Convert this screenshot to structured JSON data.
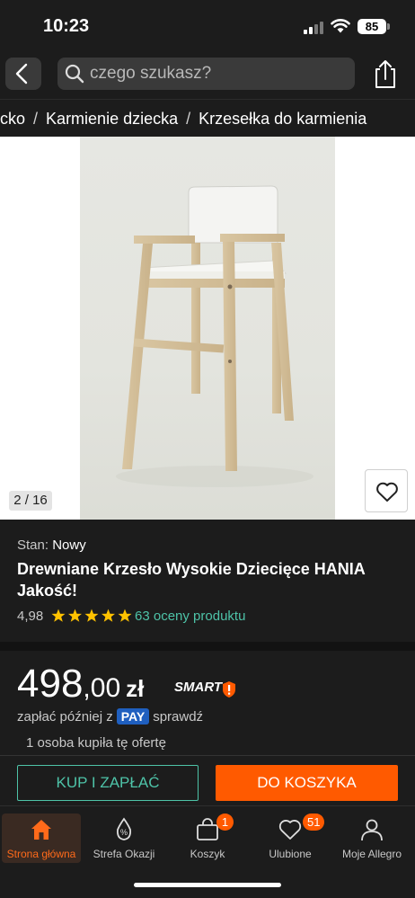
{
  "status_bar": {
    "time": "10:23",
    "battery": "85"
  },
  "search": {
    "placeholder": "czego szukasz?"
  },
  "breadcrumb": {
    "items": [
      "ecko",
      "Karmienie dziecka",
      "Krzesełka do karmienia"
    ],
    "separator": "/"
  },
  "gallery": {
    "counter": "2 / 16"
  },
  "product": {
    "condition_label": "Stan:",
    "condition_value": "Nowy",
    "title": "Drewniane Krzesło Wysokie Dziecięce HANIA Jakość!",
    "rating": "4,98",
    "stars": 5,
    "ratings_link": "63 oceny produktu"
  },
  "price": {
    "main": "498",
    "cents": ",00",
    "currency": "zł",
    "smart": "SMART"
  },
  "pay_later": {
    "text": "zapłać później z",
    "badge": "PAY",
    "link": "sprawdź"
  },
  "bought_info": "1 osoba kupiła tę ofertę",
  "actions": {
    "buy_now": "KUP I ZAPŁAĆ",
    "add_to_cart": "DO KOSZYKA"
  },
  "tabs": [
    {
      "label": "Strona główna",
      "icon": "home-icon",
      "active": true
    },
    {
      "label": "Strefa Okazji",
      "icon": "percent-tag-icon"
    },
    {
      "label": "Koszyk",
      "icon": "cart-icon",
      "badge": "1"
    },
    {
      "label": "Ulubione",
      "icon": "heart-icon",
      "badge": "51"
    },
    {
      "label": "Moje Allegro",
      "icon": "user-icon"
    }
  ],
  "colors": {
    "accent": "#ff5a00",
    "link": "#4ec3a8",
    "background": "#1c1c1c",
    "star": "#ffc200"
  }
}
